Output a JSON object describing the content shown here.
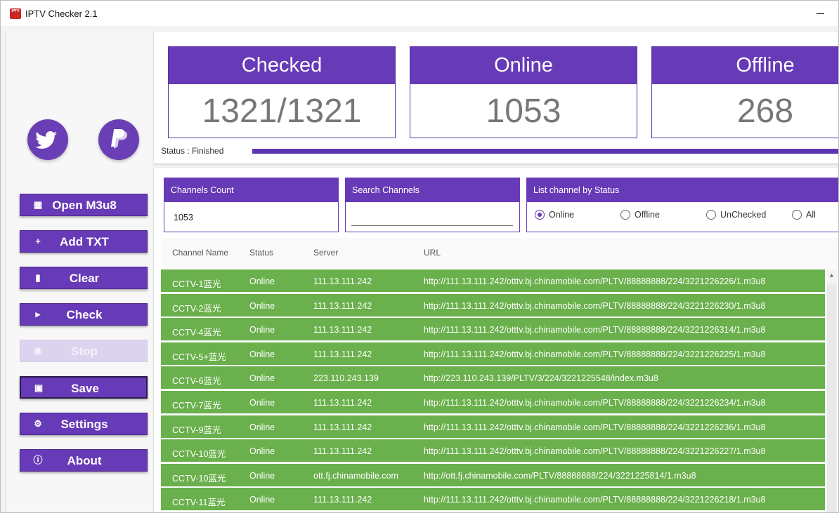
{
  "window": {
    "title": "IPTV Checker 2.1",
    "logo_text": "IPTV"
  },
  "sidebar": {
    "social": [
      {
        "icon": "twitter-icon"
      },
      {
        "icon": "paypal-icon"
      }
    ],
    "buttons": [
      {
        "label": "Open M3u8",
        "icon": "file-import-icon"
      },
      {
        "label": "Add TXT",
        "icon": "plus-icon"
      },
      {
        "label": "Clear",
        "icon": "trash-icon"
      },
      {
        "label": "Check",
        "icon": "play-icon"
      },
      {
        "label": "Stop",
        "icon": "stop-icon",
        "disabled": true
      },
      {
        "label": "Save",
        "icon": "save-icon"
      },
      {
        "label": "Settings",
        "icon": "gear-icon"
      },
      {
        "label": "About",
        "icon": "info-icon"
      }
    ]
  },
  "stats": {
    "checked": {
      "label": "Checked",
      "value": "1321/1321"
    },
    "online": {
      "label": "Online",
      "value": "1053"
    },
    "offline": {
      "label": "Offline",
      "value": "268"
    }
  },
  "status": {
    "text": "Status : Finished",
    "progress": 1.0
  },
  "filters": {
    "channels_count": {
      "label": "Channels Count",
      "value": "1053"
    },
    "search": {
      "label": "Search Channels",
      "value": ""
    },
    "status_filter": {
      "label": "List channel by Status",
      "options": [
        "Online",
        "Offline",
        "UnChecked",
        "All"
      ],
      "selected": "Online"
    }
  },
  "table": {
    "columns": [
      "Channel Name",
      "Status",
      "Server",
      "URL"
    ],
    "rows": [
      [
        "CCTV-1蓝光",
        "Online",
        "111.13.111.242",
        "http://111.13.111.242/otttv.bj.chinamobile.com/PLTV/88888888/224/3221226226/1.m3u8"
      ],
      [
        "CCTV-2蓝光",
        "Online",
        "111.13.111.242",
        "http://111.13.111.242/otttv.bj.chinamobile.com/PLTV/88888888/224/3221226230/1.m3u8"
      ],
      [
        "CCTV-4蓝光",
        "Online",
        "111.13.111.242",
        "http://111.13.111.242/otttv.bj.chinamobile.com/PLTV/88888888/224/3221226314/1.m3u8"
      ],
      [
        "CCTV-5+蓝光",
        "Online",
        "111.13.111.242",
        "http://111.13.111.242/otttv.bj.chinamobile.com/PLTV/88888888/224/3221226225/1.m3u8"
      ],
      [
        "CCTV-6蓝光",
        "Online",
        "223.110.243.139",
        "http://223.110.243.139/PLTV/3/224/3221225548/index.m3u8"
      ],
      [
        "CCTV-7蓝光",
        "Online",
        "111.13.111.242",
        "http://111.13.111.242/otttv.bj.chinamobile.com/PLTV/88888888/224/3221226234/1.m3u8"
      ],
      [
        "CCTV-9蓝光",
        "Online",
        "111.13.111.242",
        "http://111.13.111.242/otttv.bj.chinamobile.com/PLTV/88888888/224/3221226236/1.m3u8"
      ],
      [
        "CCTV-10蓝光",
        "Online",
        "111.13.111.242",
        "http://111.13.111.242/otttv.bj.chinamobile.com/PLTV/88888888/224/3221226227/1.m3u8"
      ],
      [
        "CCTV-10蓝光",
        "Online",
        "ott.fj.chinamobile.com",
        "http://ott.fj.chinamobile.com/PLTV/88888888/224/3221225814/1.m3u8"
      ],
      [
        "CCTV-11蓝光",
        "Online",
        "111.13.111.242",
        "http://111.13.111.242/otttv.bj.chinamobile.com/PLTV/88888888/224/3221226218/1.m3u8"
      ]
    ]
  },
  "colors": {
    "accent": "#673ab7",
    "online_row": "#6ab04c"
  }
}
